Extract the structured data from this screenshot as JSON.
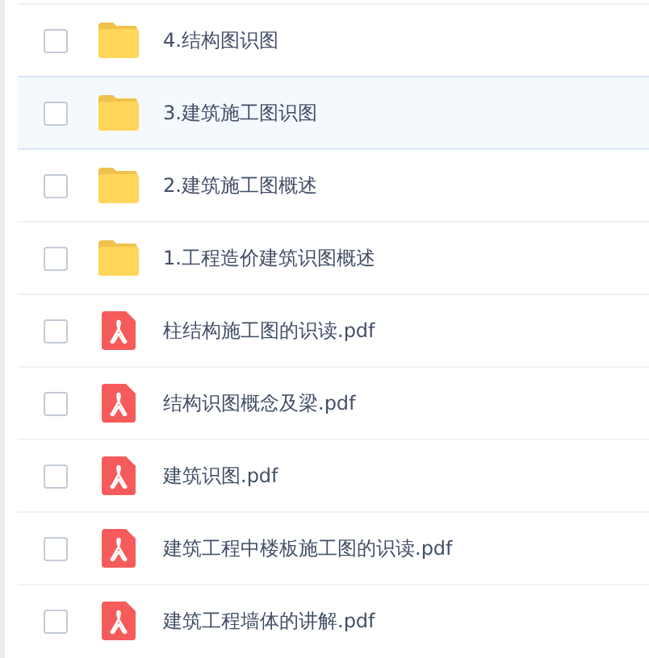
{
  "files": [
    {
      "kind": "folder",
      "name": "4.结构图识图",
      "checked": false,
      "highlighted": false
    },
    {
      "kind": "folder",
      "name": "3.建筑施工图识图",
      "checked": false,
      "highlighted": true
    },
    {
      "kind": "folder",
      "name": "2.建筑施工图概述",
      "checked": false,
      "highlighted": false
    },
    {
      "kind": "folder",
      "name": "1.工程造价建筑识图概述",
      "checked": false,
      "highlighted": false
    },
    {
      "kind": "pdf",
      "name": "柱结构施工图的识读.pdf",
      "checked": false,
      "highlighted": false
    },
    {
      "kind": "pdf",
      "name": "结构识图概念及梁.pdf",
      "checked": false,
      "highlighted": false
    },
    {
      "kind": "pdf",
      "name": "建筑识图.pdf",
      "checked": false,
      "highlighted": false
    },
    {
      "kind": "pdf",
      "name": "建筑工程中楼板施工图的识读.pdf",
      "checked": false,
      "highlighted": false
    },
    {
      "kind": "pdf",
      "name": "建筑工程墙体的讲解.pdf",
      "checked": false,
      "highlighted": false
    }
  ]
}
